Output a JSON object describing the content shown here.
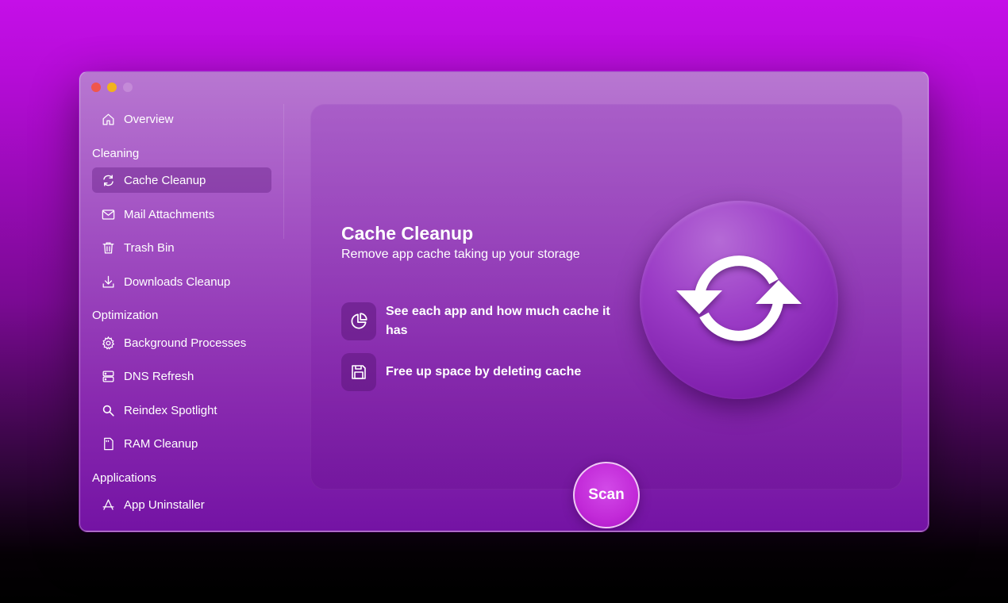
{
  "sidebar": {
    "overview": {
      "label": "Overview",
      "icon": "home-icon"
    },
    "sections": {
      "cleaning": "Cleaning",
      "optimization": "Optimization",
      "applications": "Applications"
    },
    "cleaning_items": [
      {
        "label": "Cache Cleanup",
        "icon": "refresh-icon",
        "active": true
      },
      {
        "label": "Mail Attachments",
        "icon": "mail-icon"
      },
      {
        "label": "Trash Bin",
        "icon": "trash-icon"
      },
      {
        "label": "Downloads Cleanup",
        "icon": "download-icon"
      }
    ],
    "optimization_items": [
      {
        "label": "Background Processes",
        "icon": "gear-icon"
      },
      {
        "label": "DNS Refresh",
        "icon": "server-icon"
      },
      {
        "label": "Reindex Spotlight",
        "icon": "search-icon"
      },
      {
        "label": "RAM Cleanup",
        "icon": "memory-card-icon"
      }
    ],
    "application_items": [
      {
        "label": "App Uninstaller",
        "icon": "app-store-icon"
      }
    ]
  },
  "main": {
    "title": "Cache Cleanup",
    "subtitle": "Remove app cache taking up your storage",
    "features": [
      {
        "text": "See each app and how much cache it has",
        "icon": "pie-chart-icon"
      },
      {
        "text": "Free up space by deleting cache",
        "icon": "floppy-disk-icon"
      }
    ],
    "hero_icon": "refresh-icon",
    "scan_label": "Scan"
  },
  "colors": {
    "accent": "#c22ad8",
    "window_top": "#b877d1",
    "window_bottom": "#7413a4"
  }
}
